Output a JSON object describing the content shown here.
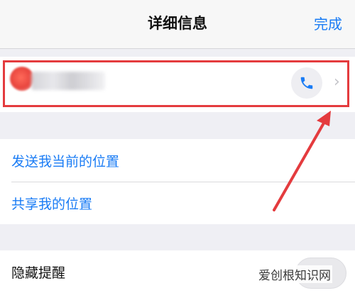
{
  "navbar": {
    "title": "详细信息",
    "done_label": "完成"
  },
  "contact": {
    "call_icon": "phone-icon",
    "chevron_icon": "chevron-right-icon",
    "highlight_color": "#e43b3e"
  },
  "location": {
    "send_current": "发送我当前的位置",
    "share_location": "共享我的位置"
  },
  "settings": {
    "hide_alerts_label": "隐藏提醒",
    "hide_alerts_enabled": false
  },
  "watermark": "爱创根知识网",
  "colors": {
    "accent": "#1a7cf5",
    "annotation": "#e43b3e",
    "background": "#efeff4"
  }
}
